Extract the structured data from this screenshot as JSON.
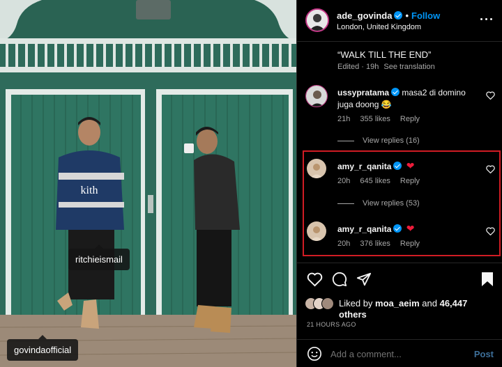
{
  "post": {
    "tags": [
      "ritchieismail",
      "govindaofficial"
    ]
  },
  "header": {
    "username": "ade_govinda",
    "dot": "•",
    "follow": "Follow",
    "location": "London, United Kingdom"
  },
  "caption": {
    "text": "“WALK TILL THE END”",
    "edited": "Edited · 19h",
    "see_translation": "See translation"
  },
  "comments": [
    {
      "username": "ussypratama",
      "text_line1": "masa2 di domino",
      "text_line2": "juga doong",
      "emoji": "😂",
      "time": "21h",
      "likes": "355 likes",
      "reply": "Reply",
      "view_replies": "View replies (16)"
    },
    {
      "username": "amy_r_qanita",
      "emoji": "❤",
      "time": "20h",
      "likes": "645 likes",
      "reply": "Reply",
      "view_replies": "View replies (53)"
    },
    {
      "username": "amy_r_qanita",
      "emoji": "❤",
      "time": "20h",
      "likes": "376 likes",
      "reply": "Reply"
    }
  ],
  "likes": {
    "prefix": "Liked by",
    "user": "moa_aeim",
    "and": "and",
    "count": "46,447",
    "others": "others"
  },
  "time_ago": "21 HOURS AGO",
  "add_comment": {
    "placeholder": "Add a comment...",
    "post": "Post"
  },
  "colors": {
    "accent": "#0095f6",
    "highlight_box": "#d01c24",
    "heart_red": "#ed1c3a"
  }
}
